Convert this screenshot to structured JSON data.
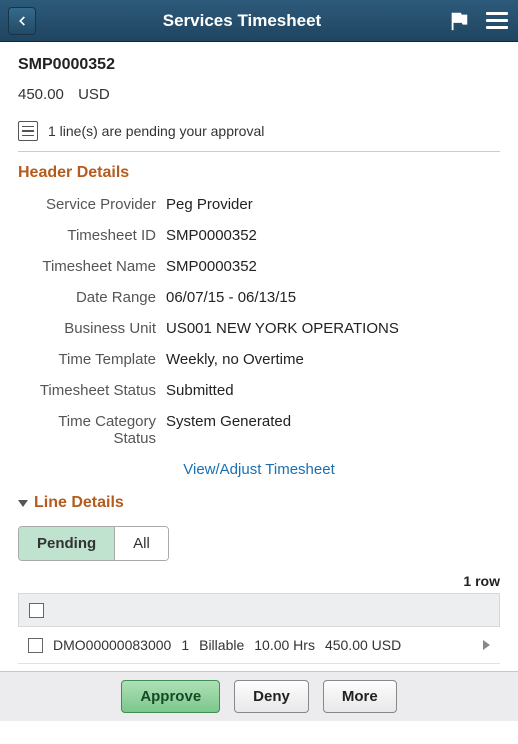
{
  "header": {
    "title": "Services Timesheet"
  },
  "summary": {
    "doc_id": "SMP0000352",
    "amount": "450.00",
    "currency": "USD",
    "pending_msg": "1 line(s) are pending your approval"
  },
  "section_titles": {
    "header_details": "Header Details",
    "line_details": "Line Details"
  },
  "details": {
    "service_provider": {
      "label": "Service Provider",
      "value": "Peg Provider"
    },
    "timesheet_id": {
      "label": "Timesheet ID",
      "value": "SMP0000352"
    },
    "timesheet_name": {
      "label": "Timesheet Name",
      "value": "SMP0000352"
    },
    "date_range": {
      "label": "Date Range",
      "value": "06/07/15    -    06/13/15"
    },
    "business_unit": {
      "label": "Business Unit",
      "value": "US001 NEW YORK OPERATIONS"
    },
    "time_template": {
      "label": "Time Template",
      "value": "Weekly, no Overtime"
    },
    "timesheet_status": {
      "label": "Timesheet Status",
      "value": "Submitted"
    },
    "time_cat_status": {
      "label": "Time Category Status",
      "value": "System Generated"
    }
  },
  "link": {
    "view_adjust": "View/Adjust Timesheet"
  },
  "filters": {
    "pending": "Pending",
    "all": "All"
  },
  "table": {
    "row_count": "1 row",
    "rows": [
      {
        "id": "DMO00000083000",
        "seq": "1",
        "type": "Billable",
        "hours": "10.00 Hrs",
        "amount": "450.00 USD"
      }
    ]
  },
  "footer": {
    "approve": "Approve",
    "deny": "Deny",
    "more": "More"
  }
}
